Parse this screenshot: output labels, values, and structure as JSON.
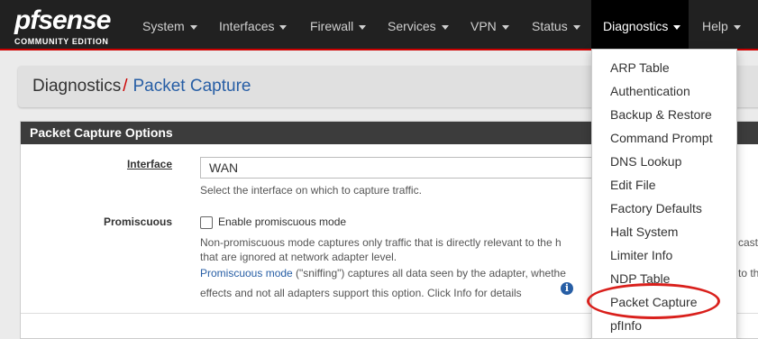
{
  "brand": {
    "name_pf": "pf",
    "name_sense": "sense",
    "edition": "COMMUNITY EDITION"
  },
  "nav": [
    {
      "label": "System"
    },
    {
      "label": "Interfaces"
    },
    {
      "label": "Firewall"
    },
    {
      "label": "Services"
    },
    {
      "label": "VPN"
    },
    {
      "label": "Status"
    },
    {
      "label": "Diagnostics"
    },
    {
      "label": "Help"
    }
  ],
  "breadcrumb": {
    "parent": "Diagnostics",
    "separator": "/",
    "current": "Packet Capture"
  },
  "panel": {
    "title": "Packet Capture Options"
  },
  "interface": {
    "label": "Interface",
    "value": "WAN",
    "help": "Select the interface on which to capture traffic."
  },
  "promiscuous": {
    "label": "Promiscuous",
    "checkbox_label": "Enable promiscuous mode",
    "help_line1": "Non-promiscuous mode captures only traffic that is directly relevant to the h",
    "help_line1_tail": "cast",
    "help_line2": "that are ignored at network adapter level.",
    "help_link": "Promiscuous mode",
    "help_line3": " (\"sniffing\") captures all data seen by the adapter, whethe",
    "help_line3_tail": "to the",
    "help_line4": "effects and not all adapters support this option. Click Info for details",
    "info_icon": "i"
  },
  "dropdown": [
    "ARP Table",
    "Authentication",
    "Backup & Restore",
    "Command Prompt",
    "DNS Lookup",
    "Edit File",
    "Factory Defaults",
    "Halt System",
    "Limiter Info",
    "NDP Table",
    "Packet Capture",
    "pfInfo"
  ],
  "colors": {
    "accent_red": "#cc0000",
    "link_blue": "#275ea5",
    "navbar": "#212121"
  }
}
